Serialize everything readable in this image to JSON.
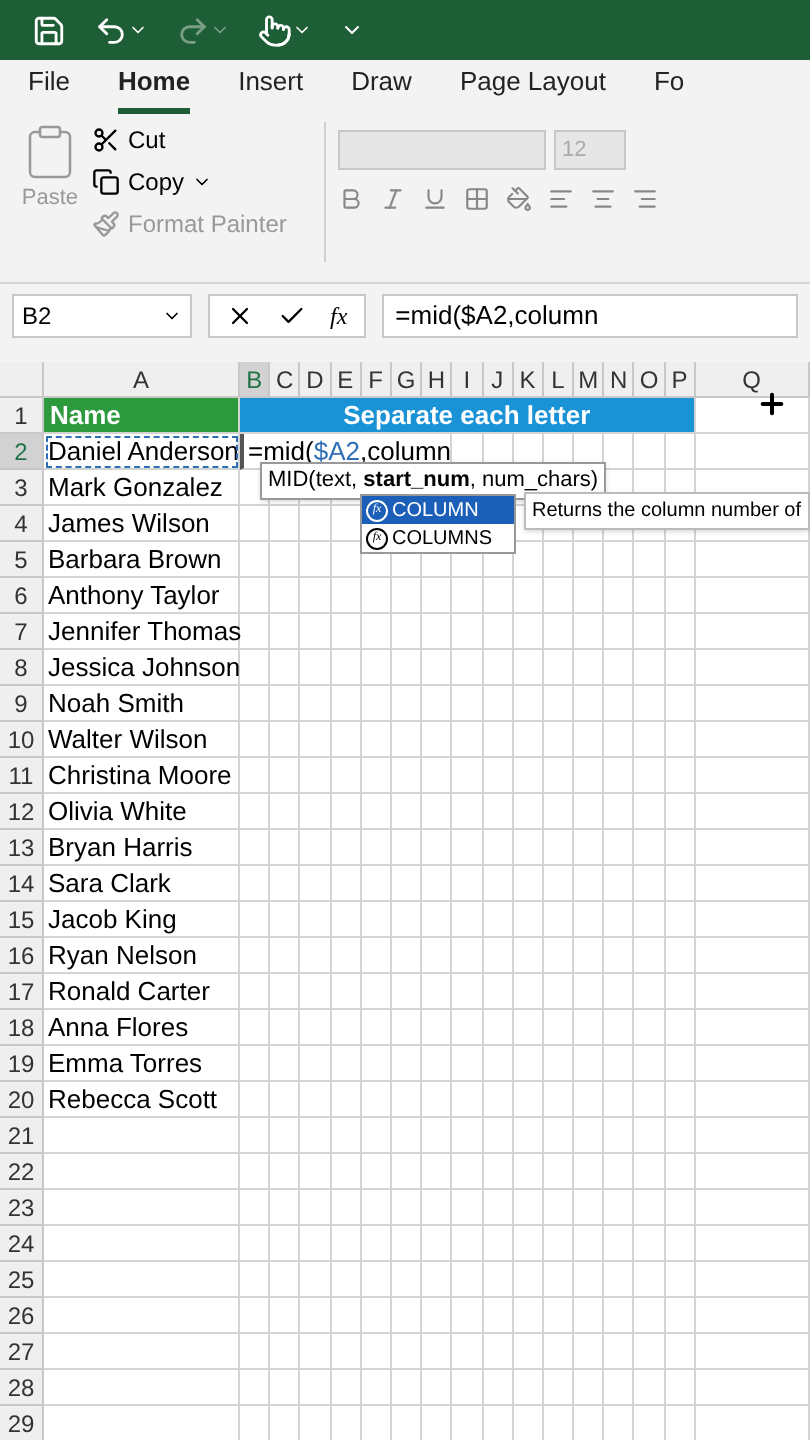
{
  "tabs": [
    {
      "label": "File",
      "selected": false
    },
    {
      "label": "Home",
      "selected": true
    },
    {
      "label": "Insert",
      "selected": false
    },
    {
      "label": "Draw",
      "selected": false
    },
    {
      "label": "Page Layout",
      "selected": false
    },
    {
      "label": "Fo",
      "selected": false
    }
  ],
  "clipboard": {
    "paste": "Paste",
    "cut": "Cut",
    "copy": "Copy",
    "format_painter": "Format Painter"
  },
  "font": {
    "size": "12",
    "disabled": true
  },
  "name_box": "B2",
  "insert_function": "fx",
  "formula": "=mid($A2,column",
  "columns": [
    "A",
    "B",
    "C",
    "D",
    "E",
    "F",
    "G",
    "H",
    "I",
    "J",
    "K",
    "L",
    "M",
    "N",
    "O",
    "P",
    "Q"
  ],
  "rows": [
    {
      "kind": "header",
      "number": "1",
      "name": "Name",
      "title": "Separate each letter"
    },
    {
      "kind": "edit",
      "number": "2",
      "name": "Daniel Anderson",
      "formula_parts": [
        "=mid(",
        "$A2",
        ",column"
      ]
    },
    {
      "kind": "name",
      "number": "3",
      "name": "Mark Gonzalez"
    },
    {
      "kind": "name",
      "number": "4",
      "name": "James Wilson"
    },
    {
      "kind": "name",
      "number": "5",
      "name": "Barbara Brown"
    },
    {
      "kind": "name",
      "number": "6",
      "name": "Anthony Taylor"
    },
    {
      "kind": "name",
      "number": "7",
      "name": "Jennifer Thomas"
    },
    {
      "kind": "name",
      "number": "8",
      "name": "Jessica Johnson"
    },
    {
      "kind": "name",
      "number": "9",
      "name": "Noah Smith"
    },
    {
      "kind": "name",
      "number": "10",
      "name": "Walter Wilson"
    },
    {
      "kind": "name",
      "number": "11",
      "name": "Christina Moore"
    },
    {
      "kind": "name",
      "number": "12",
      "name": "Olivia White"
    },
    {
      "kind": "name",
      "number": "13",
      "name": "Bryan Harris"
    },
    {
      "kind": "name",
      "number": "14",
      "name": "Sara Clark"
    },
    {
      "kind": "name",
      "number": "15",
      "name": "Jacob King"
    },
    {
      "kind": "name",
      "number": "16",
      "name": "Ryan Nelson"
    },
    {
      "kind": "name",
      "number": "17",
      "name": "Ronald Carter"
    },
    {
      "kind": "name",
      "number": "18",
      "name": "Anna Flores"
    },
    {
      "kind": "name",
      "number": "19",
      "name": "Emma Torres"
    },
    {
      "kind": "name",
      "number": "20",
      "name": "Rebecca Scott"
    },
    {
      "kind": "empty",
      "number": "21"
    },
    {
      "kind": "empty",
      "number": "22"
    },
    {
      "kind": "empty",
      "number": "23"
    },
    {
      "kind": "empty",
      "number": "24"
    },
    {
      "kind": "empty",
      "number": "25"
    },
    {
      "kind": "empty",
      "number": "26"
    },
    {
      "kind": "empty",
      "number": "27"
    },
    {
      "kind": "empty",
      "number": "28"
    },
    {
      "kind": "empty",
      "number": "29"
    }
  ],
  "tooltip": "MID(text, **start_num**, num_chars)",
  "suggestions": [
    {
      "icon": "fx",
      "label": "COLUMN",
      "selected": true
    },
    {
      "icon": "fx",
      "label": "COLUMNS",
      "selected": false
    }
  ],
  "suggestion_description": "Returns the column number of"
}
